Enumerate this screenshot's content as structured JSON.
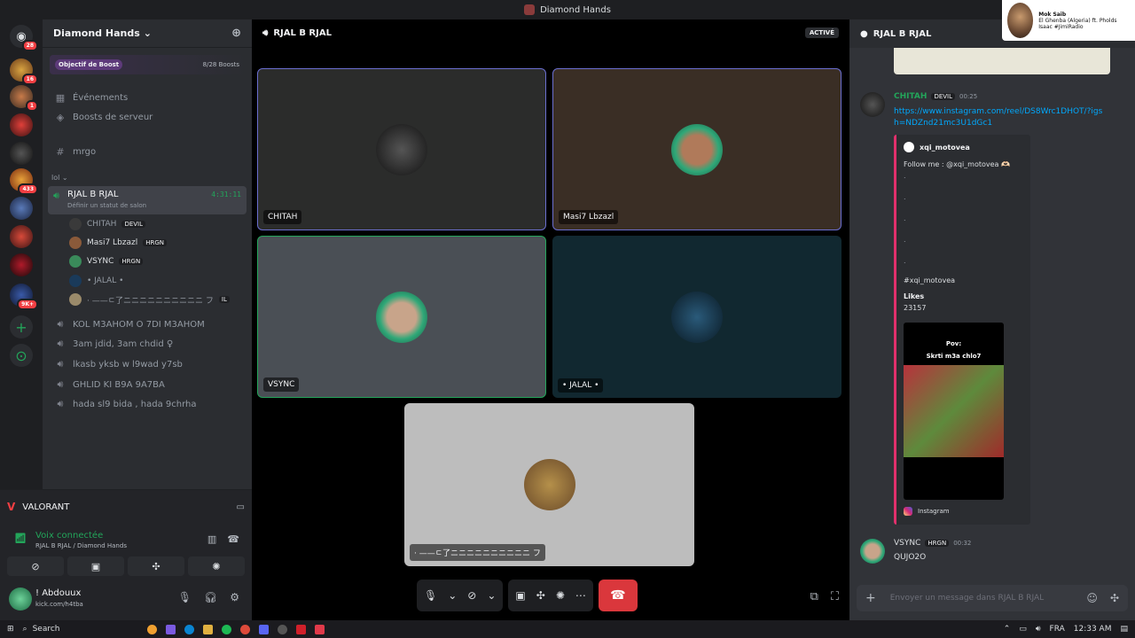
{
  "window": {
    "title": "Diamond Hands"
  },
  "preview": {
    "name": "Mok Saib",
    "sub": "El Ghenba (Algeria) ft. Pholds Isaac #JimiRadio"
  },
  "servers": {
    "badges": [
      "28",
      "16",
      "1",
      "433",
      "9K+"
    ]
  },
  "sidebar": {
    "server_name": "Diamond Hands",
    "boost": {
      "label": "Objectif de Boost",
      "count": "8/28 Boosts"
    },
    "items": [
      {
        "icon": "calendar-icon",
        "label": "Événements"
      },
      {
        "icon": "boost-icon",
        "label": "Boosts de serveur"
      }
    ],
    "text_channel": "mrgo",
    "category": "lol",
    "active_voice": {
      "name": "RJAL B RJAL",
      "status": "Définir un statut de salon",
      "timer": "4:31:11"
    },
    "members": [
      {
        "name": "CHITAH",
        "tag": "DEVIL"
      },
      {
        "name": "Masi7 Lbzazl",
        "tag": "HRGN"
      },
      {
        "name": "VSYNC",
        "tag": "HRGN"
      },
      {
        "name": "• JALAL •",
        "tag": ""
      },
      {
        "name": "· ——ㄷ了ニニニニニニニニニニ フ",
        "tag": "IL"
      }
    ],
    "voice_channels": [
      "KOL M3AHOM O 7DI M3AHOM",
      "3am jdid, 3am chdid ♀",
      "lkasb yksb w l9wad y7sb",
      "GHLID KI B9A 9A7BA",
      "hada sl9 bida , hada 9chrha"
    ]
  },
  "activity": {
    "game": "VALORANT",
    "voice_status": "Voix connectée",
    "voice_channel": "RJAL B RJAL / Diamond Hands",
    "user": {
      "name": "! Abdouux",
      "status": "kick.com/h4tba"
    }
  },
  "stage": {
    "channel": "RJAL B RJAL",
    "active_label": "ACTIVÉ",
    "tiles": [
      {
        "name": "CHITAH"
      },
      {
        "name": "Masi7 Lbzazl"
      },
      {
        "name": "VSYNC"
      },
      {
        "name": "• JALAL •"
      },
      {
        "name": "· ——ㄷ了ニニニニニニニニニニ フ"
      }
    ]
  },
  "chat": {
    "channel": "RJAL B RJAL",
    "messages": [
      {
        "author": "CHITAH",
        "tag": "DEVIL",
        "time": "00:25",
        "link": "https://www.instagram.com/reel/DS8Wrc1DHOT/?igsh=NDZnd21mc3U1dGc1"
      },
      {
        "author": "VSYNC",
        "tag": "HRGN",
        "time": "00:32",
        "text": "QUJO2O"
      }
    ],
    "embed": {
      "author": "xqi_motovea",
      "desc": "Follow me : @xqi_motovea 🫶🏻",
      "hashtag": "#xqi_motovea",
      "likes_label": "Likes",
      "likes": "23157",
      "video_caption_1": "Pov:",
      "video_caption_2": "Skrti m3a chlo7",
      "footer": "Instagram"
    },
    "input_placeholder": "Envoyer un message dans RJAL B RJAL"
  },
  "taskbar": {
    "search": "Search",
    "lang": "FRA",
    "time": "12:33 AM"
  },
  "colors": {
    "accent": "#5865f2",
    "green": "#23a55a",
    "red": "#da373c"
  }
}
